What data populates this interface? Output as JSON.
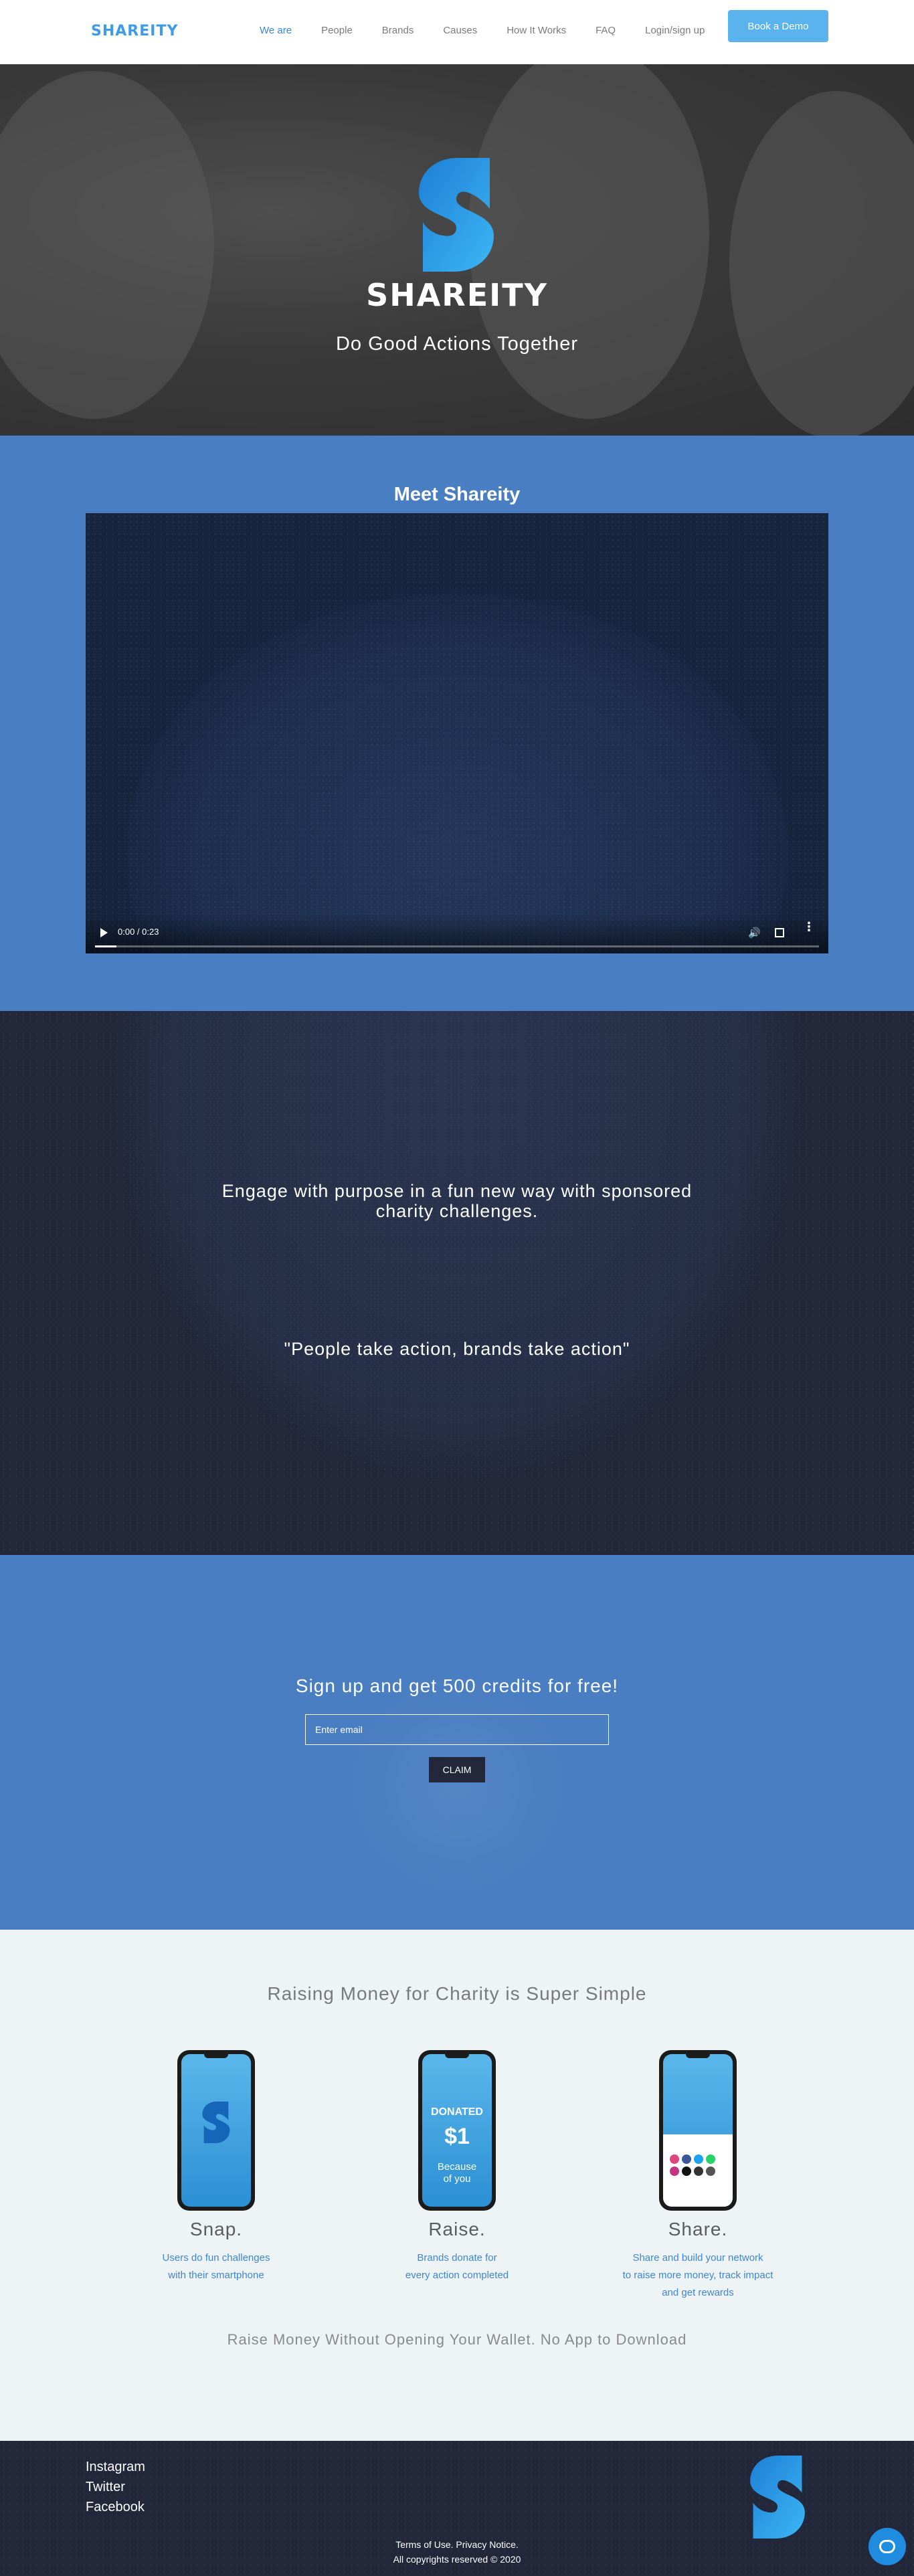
{
  "header": {
    "logo": "SHAREITY",
    "nav": [
      "We are",
      "People",
      "Brands",
      "Causes",
      "How It Works",
      "FAQ",
      "Login/sign up"
    ],
    "active_nav": "We are",
    "demo_button": "Book a Demo"
  },
  "hero": {
    "brand": "SHAREITY",
    "tagline": "Do Good Actions Together"
  },
  "meet": {
    "title": "Meet Shareity",
    "video": {
      "time": "0:00 / 0:23",
      "progress_fraction": 0.03
    }
  },
  "engage": {
    "text_line1": "Engage with purpose in a fun new way with sponsored",
    "text_line2": "charity challenges.",
    "quote": "\"People take action, brands take action\""
  },
  "signup": {
    "title": "Sign up and get 500 credits for free!",
    "email_placeholder": "Enter email",
    "claim": "CLAIM"
  },
  "simple": {
    "title": "Raising Money for Charity is Super Simple",
    "steps": [
      {
        "name": "Snap.",
        "desc_lines": [
          "Users do fun challenges",
          "with their smartphone"
        ]
      },
      {
        "name": "Raise.",
        "desc_lines": [
          "Brands donate for",
          "every action completed"
        ],
        "phone_donated": "DONATED",
        "phone_amount": "$1",
        "phone_because": [
          "Because",
          "of you"
        ]
      },
      {
        "name": "Share.",
        "desc_lines": [
          "Share and build your network",
          "to raise more money, track impact",
          "and get rewards"
        ]
      }
    ],
    "footer_line": "Raise Money Without Opening Your Wallet. No App to Download"
  },
  "footer": {
    "social": [
      "Instagram",
      "Twitter",
      "Facebook"
    ],
    "legal_line1": "Terms of Use. Privacy Notice.",
    "legal_line2": "All copyrights reserved © 2020"
  },
  "colors": {
    "brand_blue": "#3d9be8",
    "section_blue": "#4a7ec2",
    "navy": "#222839",
    "button_light_blue": "#5bb3ee"
  }
}
